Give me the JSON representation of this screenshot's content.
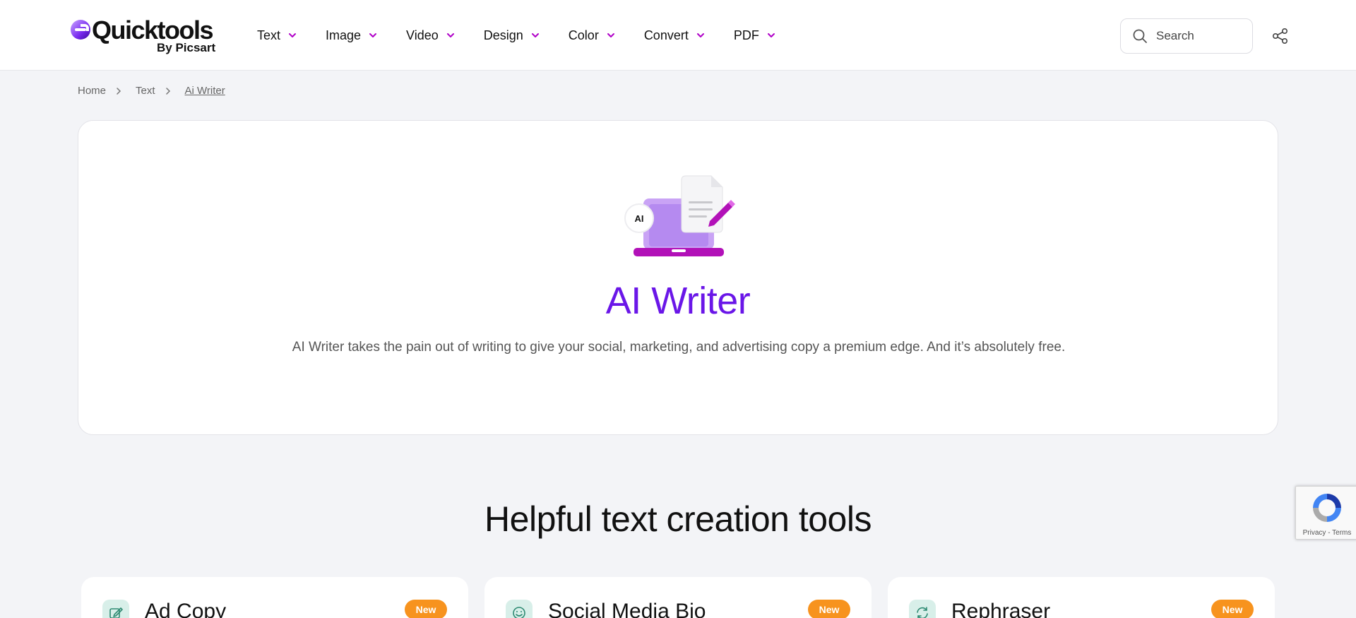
{
  "header": {
    "logo_name": "Quicktools",
    "logo_sub": "By Picsart",
    "nav": [
      {
        "label": "Text"
      },
      {
        "label": "Image"
      },
      {
        "label": "Video"
      },
      {
        "label": "Design"
      },
      {
        "label": "Color"
      },
      {
        "label": "Convert"
      },
      {
        "label": "PDF"
      }
    ],
    "search_placeholder": "Search"
  },
  "breadcrumb": {
    "items": [
      "Home",
      "Text",
      "Ai Writer"
    ]
  },
  "hero": {
    "badge_text": "AI",
    "title": "AI Writer",
    "description": "AI Writer takes the pain out of writing to give your social, marketing, and advertising copy a premium edge. And it’s absolutely free."
  },
  "section": {
    "title": "Helpful text creation tools"
  },
  "tools": [
    {
      "title": "Ad Copy",
      "badge": "New",
      "icon": "pencil-edit-icon"
    },
    {
      "title": "Social Media Bio",
      "badge": "New",
      "icon": "smiley-icon"
    },
    {
      "title": "Rephraser",
      "badge": "New",
      "icon": "refresh-icon"
    }
  ],
  "recaptcha": {
    "text": "Privacy - Terms"
  },
  "colors": {
    "accent": "#6a16e8",
    "chevron": "#b000c8",
    "badge": "#f7931e",
    "tool_icon_bg": "#d8efe9"
  }
}
